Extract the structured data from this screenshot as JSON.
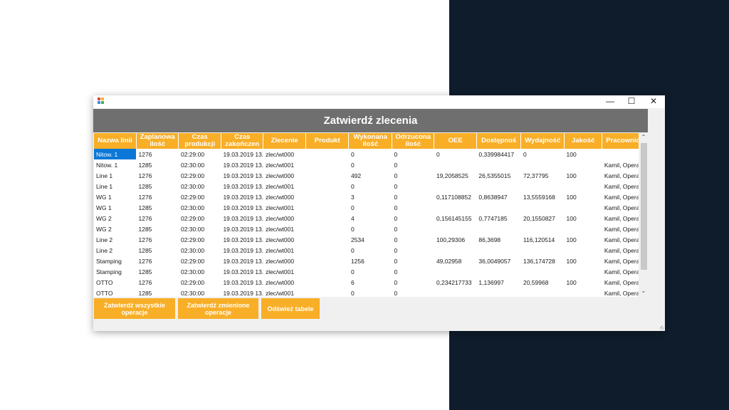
{
  "window": {
    "header_title": "Zatwierdź zlecenia",
    "minimize_glyph": "—",
    "maximize_glyph": "☐",
    "close_glyph": "✕"
  },
  "table": {
    "columns": [
      "Nazwa linii",
      "Zaplanowa ilość",
      "Czas produkcji",
      "Czas zakończen",
      "Zlecenie",
      "Produkt",
      "Wykonana ilość",
      "Odrzucona ilość",
      "OEE",
      "Dostępnoś",
      "Wydajność",
      "Jakość",
      "Pracownicy"
    ],
    "rows": [
      [
        "Nitow. 1",
        "1276",
        "02:29:00",
        "19.03.2019 13...",
        "zlec/wt000",
        "",
        "0",
        "0",
        "0",
        "0,339984417",
        "0",
        "100",
        ""
      ],
      [
        "Nitow. 1",
        "1285",
        "02:30:00",
        "19.03.2019 13...",
        "zlec/wt001",
        "",
        "0",
        "0",
        "",
        "",
        "",
        "",
        "Kamil, Operat..."
      ],
      [
        "Line 1",
        "1276",
        "02:29:00",
        "19.03.2019 13...",
        "zlec/wt000",
        "",
        "492",
        "0",
        "19,2058525",
        "26,5355015",
        "72,37795",
        "100",
        "Kamil, Operat..."
      ],
      [
        "Line 1",
        "1285",
        "02:30:00",
        "19.03.2019 13...",
        "zlec/wt001",
        "",
        "0",
        "0",
        "",
        "",
        "",
        "",
        "Kamil, Operat..."
      ],
      [
        "WG 1",
        "1276",
        "02:29:00",
        "19.03.2019 13...",
        "zlec/wt000",
        "",
        "3",
        "0",
        "0,117108852",
        "0,8638947",
        "13,5559168",
        "100",
        "Kamil, Operat..."
      ],
      [
        "WG 1",
        "1285",
        "02:30:00",
        "19.03.2019 13...",
        "zlec/wt001",
        "",
        "0",
        "0",
        "",
        "",
        "",
        "",
        "Kamil, Operat..."
      ],
      [
        "WG 2",
        "1276",
        "02:29:00",
        "19.03.2019 13...",
        "zlec/wt000",
        "",
        "4",
        "0",
        "0,156145155",
        "0,7747185",
        "20,1550827",
        "100",
        "Kamil, Operat..."
      ],
      [
        "WG 2",
        "1285",
        "02:30:00",
        "19.03.2019 13...",
        "zlec/wt001",
        "",
        "0",
        "0",
        "",
        "",
        "",
        "",
        "Kamil, Operat..."
      ],
      [
        "Line 2",
        "1276",
        "02:29:00",
        "19.03.2019 13...",
        "zlec/wt000",
        "",
        "2534",
        "0",
        "100,29306",
        "86,3698",
        "116,120514",
        "100",
        "Kamil, Operat..."
      ],
      [
        "Line 2",
        "1285",
        "02:30:00",
        "19.03.2019 13...",
        "zlec/wt001",
        "",
        "0",
        "0",
        "",
        "",
        "",
        "",
        "Kamil, Operat..."
      ],
      [
        "Stamping",
        "1276",
        "02:29:00",
        "19.03.2019 13...",
        "zlec/wt000",
        "",
        "1256",
        "0",
        "49,02958",
        "36,0049057",
        "136,174728",
        "100",
        "Kamil, Operat..."
      ],
      [
        "Stamping",
        "1285",
        "02:30:00",
        "19.03.2019 13...",
        "zlec/wt001",
        "",
        "0",
        "0",
        "",
        "",
        "",
        "",
        "Kamil, Operat..."
      ],
      [
        "OTTO",
        "1276",
        "02:29:00",
        "19.03.2019 13...",
        "zlec/wt000",
        "",
        "6",
        "0",
        "0,234217733",
        "1,136997",
        "20,59968",
        "100",
        "Kamil, Operat..."
      ],
      [
        "OTTO",
        "1285",
        "02:30:00",
        "19.03.2019 13...",
        "zlec/wt001",
        "",
        "0",
        "0",
        "",
        "",
        "",
        "",
        "Kamil, Operat..."
      ]
    ]
  },
  "buttons": {
    "approve_all": "Zatwierdź wszystkie operacje",
    "approve_changed": "Zatwierdź zmienione operacje",
    "refresh": "Odśwież tabele"
  },
  "scrollbar": {
    "up_glyph": "⌃",
    "down_glyph": "⌄"
  },
  "colors": {
    "accent": "#f8ae26",
    "header_bar": "#6f6f6f",
    "selection": "#0b78d7",
    "dark_panel": "#0f1c2c"
  }
}
